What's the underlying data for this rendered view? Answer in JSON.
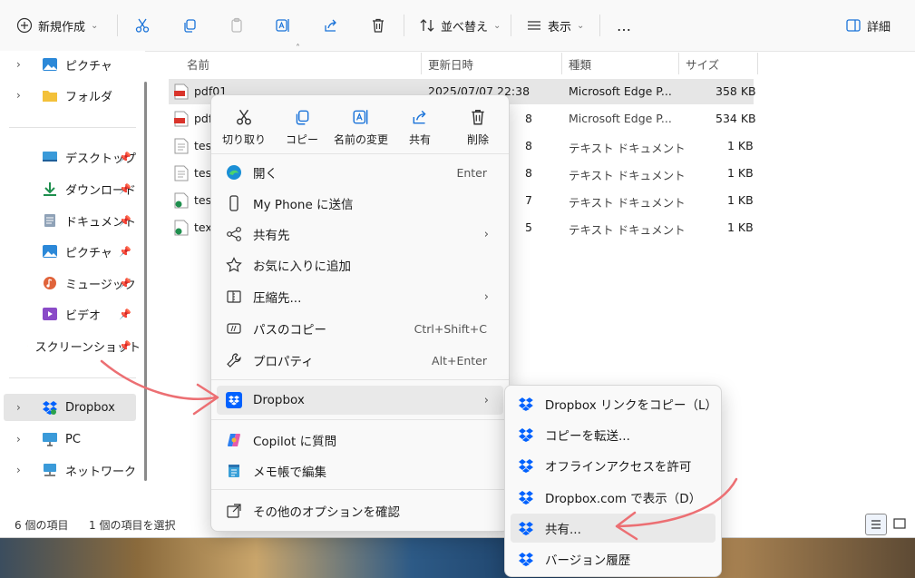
{
  "toolbar": {
    "new_label": "新規作成",
    "sort_label": "並べ替え",
    "view_label": "表示",
    "more_label": "…",
    "details_label": "詳細"
  },
  "nav": {
    "items": [
      {
        "label": "ピクチャ"
      },
      {
        "label": "フォルダ"
      },
      {
        "label": "デスクトップ"
      },
      {
        "label": "ダウンロード"
      },
      {
        "label": "ドキュメント"
      },
      {
        "label": "ピクチャ"
      },
      {
        "label": "ミュージック"
      },
      {
        "label": "ビデオ"
      },
      {
        "label": "スクリーンショット"
      },
      {
        "label": "Dropbox"
      },
      {
        "label": "PC"
      },
      {
        "label": "ネットワーク"
      }
    ]
  },
  "columns": {
    "name": "名前",
    "date": "更新日時",
    "type": "種類",
    "size": "サイズ"
  },
  "files": [
    {
      "name": "pdf01",
      "date": "2025/07/07 22:38",
      "type": "Microsoft Edge P...",
      "size": "358 KB"
    },
    {
      "name": "pdf",
      "date": "8",
      "type": "Microsoft Edge P...",
      "size": "534 KB"
    },
    {
      "name": "tes",
      "date": "8",
      "type": "テキスト ドキュメント",
      "size": "1 KB"
    },
    {
      "name": "tes",
      "date": "8",
      "type": "テキスト ドキュメント",
      "size": "1 KB"
    },
    {
      "name": "tes",
      "date": "7",
      "type": "テキスト ドキュメント",
      "size": "1 KB"
    },
    {
      "name": "tex",
      "date": "5",
      "type": "テキスト ドキュメント",
      "size": "1 KB"
    }
  ],
  "status": {
    "count": "6 個の項目",
    "selected": "1 個の項目を選択"
  },
  "context_menu": {
    "quick_actions": [
      {
        "label": "切り取り"
      },
      {
        "label": "コピー"
      },
      {
        "label": "名前の変更"
      },
      {
        "label": "共有"
      },
      {
        "label": "削除"
      }
    ],
    "items": [
      {
        "label": "開く",
        "shortcut": "Enter"
      },
      {
        "label": "My Phone に送信",
        "shortcut": ""
      },
      {
        "label": "共有先",
        "shortcut": ""
      },
      {
        "label": "お気に入りに追加",
        "shortcut": ""
      },
      {
        "label": "圧縮先...",
        "shortcut": ""
      },
      {
        "label": "パスのコピー",
        "shortcut": "Ctrl+Shift+C"
      },
      {
        "label": "プロパティ",
        "shortcut": "Alt+Enter"
      },
      {
        "label": "Dropbox",
        "shortcut": ""
      },
      {
        "label": "Copilot に質問",
        "shortcut": ""
      },
      {
        "label": "メモ帳で編集",
        "shortcut": ""
      },
      {
        "label": "その他のオプションを確認",
        "shortcut": ""
      }
    ]
  },
  "submenu": {
    "items": [
      {
        "label": "Dropbox リンクをコピー（L）"
      },
      {
        "label": "コピーを転送..."
      },
      {
        "label": "オフラインアクセスを許可"
      },
      {
        "label": "Dropbox.com で表示（D）"
      },
      {
        "label": "共有..."
      },
      {
        "label": "バージョン履歴"
      }
    ]
  },
  "colors": {
    "dropbox_blue": "#0061fe",
    "annotation_arrow": "#ec6f73",
    "pdf_red": "#d9342b"
  }
}
